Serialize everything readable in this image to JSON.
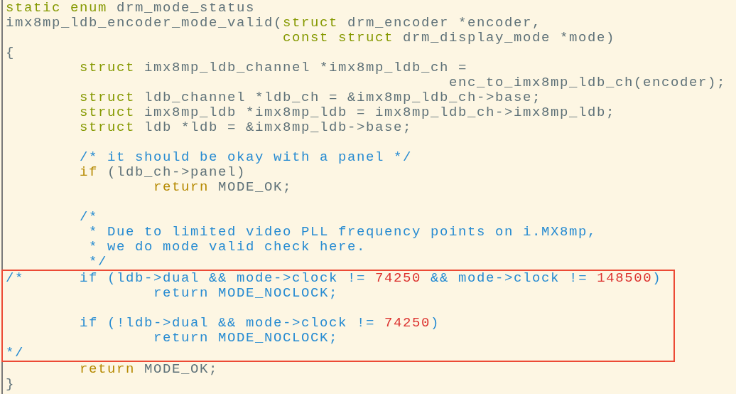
{
  "code_lines": [
    {
      "boxed": false,
      "segments": [
        {
          "kind": "keyword",
          "text": "static enum"
        },
        {
          "kind": "plain",
          "text": " drm_mode_status"
        }
      ]
    },
    {
      "boxed": false,
      "segments": [
        {
          "kind": "plain",
          "text": "imx8mp_ldb_encoder_mode_valid("
        },
        {
          "kind": "keyword",
          "text": "struct"
        },
        {
          "kind": "plain",
          "text": " drm_encoder *encoder,"
        }
      ]
    },
    {
      "boxed": false,
      "kind": "col30",
      "segments": [
        {
          "kind": "keyword",
          "text": "const struct"
        },
        {
          "kind": "plain",
          "text": " drm_display_mode *mode)"
        }
      ]
    },
    {
      "boxed": false,
      "segments": [
        {
          "kind": "plain",
          "text": "{"
        }
      ]
    },
    {
      "boxed": false,
      "kind": "tab",
      "segments": [
        {
          "kind": "keyword",
          "text": "struct"
        },
        {
          "kind": "plain",
          "text": " imx8mp_ldb_channel *imx8mp_ldb_ch ="
        }
      ]
    },
    {
      "boxed": false,
      "kind": "col48",
      "segments": [
        {
          "kind": "plain",
          "text": "enc_to_imx8mp_ldb_ch(encoder);"
        }
      ]
    },
    {
      "boxed": false,
      "kind": "tab",
      "segments": [
        {
          "kind": "keyword",
          "text": "struct"
        },
        {
          "kind": "plain",
          "text": " ldb_channel *ldb_ch = &imx8mp_ldb_ch->base;"
        }
      ]
    },
    {
      "boxed": false,
      "kind": "tab",
      "segments": [
        {
          "kind": "keyword",
          "text": "struct"
        },
        {
          "kind": "plain",
          "text": " imx8mp_ldb *imx8mp_ldb = imx8mp_ldb_ch->imx8mp_ldb;"
        }
      ]
    },
    {
      "boxed": false,
      "kind": "tab",
      "segments": [
        {
          "kind": "keyword",
          "text": "struct"
        },
        {
          "kind": "plain",
          "text": " ldb *ldb = &imx8mp_ldb->base;"
        }
      ]
    },
    {
      "boxed": false
    },
    {
      "boxed": false,
      "kind": "tab",
      "segments": [
        {
          "kind": "comment",
          "text": "/* it should be okay with a panel */"
        }
      ]
    },
    {
      "boxed": false,
      "kind": "tab",
      "segments": [
        {
          "kind": "control",
          "text": "if"
        },
        {
          "kind": "plain",
          "text": " (ldb_ch->panel)"
        }
      ]
    },
    {
      "boxed": false,
      "kind": "tab2",
      "segments": [
        {
          "kind": "control",
          "text": "return"
        },
        {
          "kind": "plain",
          "text": " MODE_OK;"
        }
      ]
    },
    {
      "boxed": false
    },
    {
      "boxed": false,
      "kind": "tab",
      "segments": [
        {
          "kind": "comment",
          "text": "/*"
        }
      ]
    },
    {
      "boxed": false,
      "kind": "tab1",
      "segments": [
        {
          "kind": "comment",
          "text": "* Due to limited video PLL frequency points on i.MX8mp,"
        }
      ]
    },
    {
      "boxed": false,
      "kind": "tab1",
      "segments": [
        {
          "kind": "comment",
          "text": "* we do mode valid check here."
        }
      ]
    },
    {
      "boxed": false,
      "kind": "tab1",
      "segments": [
        {
          "kind": "comment",
          "text": "*/"
        }
      ]
    },
    {
      "boxed": true,
      "segments": [
        {
          "kind": "comment",
          "text": "/*      if (ldb->dual && mode->clock != "
        },
        {
          "kind": "number",
          "text": "74250"
        },
        {
          "kind": "comment",
          "text": " && mode->clock != "
        },
        {
          "kind": "number",
          "text": "148500"
        },
        {
          "kind": "comment",
          "text": ")"
        }
      ]
    },
    {
      "boxed": true,
      "kind": "tab2",
      "segments": [
        {
          "kind": "comment",
          "text": "return MODE_NOCLOCK;"
        }
      ]
    },
    {
      "boxed": true
    },
    {
      "boxed": true,
      "kind": "tab",
      "segments": [
        {
          "kind": "comment",
          "text": "if (!ldb->dual && mode->clock != "
        },
        {
          "kind": "number",
          "text": "74250"
        },
        {
          "kind": "comment",
          "text": ")"
        }
      ]
    },
    {
      "boxed": true,
      "kind": "tab2",
      "segments": [
        {
          "kind": "comment",
          "text": "return MODE_NOCLOCK;"
        }
      ]
    },
    {
      "boxed": true,
      "segments": [
        {
          "kind": "comment",
          "text": "*/"
        }
      ]
    },
    {
      "boxed": false,
      "kind": "tab",
      "segments": [
        {
          "kind": "control",
          "text": "return"
        },
        {
          "kind": "plain",
          "text": " MODE_OK;"
        }
      ]
    },
    {
      "boxed": false,
      "segments": [
        {
          "kind": "plain",
          "text": "}"
        }
      ]
    }
  ]
}
